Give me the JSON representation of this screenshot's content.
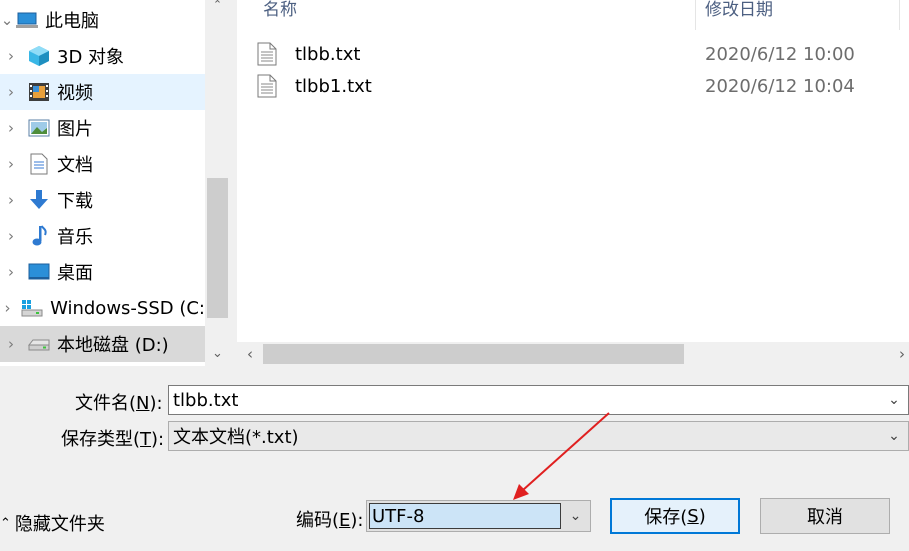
{
  "nav": {
    "items": [
      {
        "label": "此电脑",
        "icon": "computer-icon",
        "expanded": true
      },
      {
        "label": "3D 对象",
        "icon": "3d-objects-icon"
      },
      {
        "label": "视频",
        "icon": "video-icon",
        "selected": true
      },
      {
        "label": "图片",
        "icon": "pictures-icon"
      },
      {
        "label": "文档",
        "icon": "documents-icon"
      },
      {
        "label": "下载",
        "icon": "download-icon"
      },
      {
        "label": "音乐",
        "icon": "music-icon"
      },
      {
        "label": "桌面",
        "icon": "desktop-icon"
      },
      {
        "label": "Windows-SSD (C:",
        "icon": "windows-drive-icon"
      },
      {
        "label": "本地磁盘 (D:)",
        "icon": "local-disk-icon",
        "hover": true
      }
    ]
  },
  "filelist": {
    "columns": {
      "name": "名称",
      "modified": "修改日期"
    },
    "files": [
      {
        "name": "tlbb.txt",
        "modified": "2020/6/12 10:00"
      },
      {
        "name": "tlbb1.txt",
        "modified": "2020/6/12 10:04"
      }
    ]
  },
  "form": {
    "filename_label": "文件名(",
    "filename_key": "N",
    "filename_label_end": "):",
    "filename_value": "tlbb.txt",
    "type_label": "保存类型(",
    "type_key": "T",
    "type_label_end": "):",
    "type_value": "文本文档(*.txt)",
    "encoding_label": "编码(",
    "encoding_key": "E",
    "encoding_label_end": "):",
    "encoding_value": "UTF-8",
    "hide_folders": "隐藏文件夹",
    "save_label": "保存(",
    "save_key": "S",
    "save_label_end": ")",
    "cancel_label": "取消"
  },
  "colors": {
    "accent": "#0078d7",
    "selected_bg": "#e5f3ff",
    "annotation_arrow": "#e02020"
  }
}
